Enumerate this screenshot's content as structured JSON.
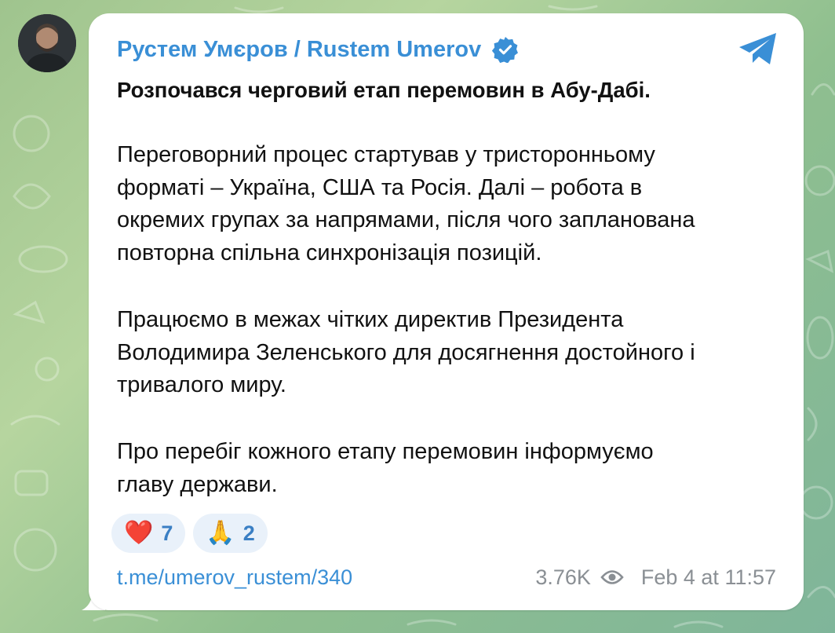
{
  "post": {
    "author": "Рустем Умєров / Rustem Umerov",
    "title": "Розпочався черговий етап перемовин в Абу-Дабі.",
    "paragraph1_lines": [
      "Переговорний процес стартував у тристоронньому",
      "форматі – Україна, США та Росія. Далі – робота в",
      "окремих групах за напрямами, після чого запланована",
      "повторна спільна синхронізація позицій."
    ],
    "paragraph2_lines": [
      "Працюємо в межах чітких директив Президента",
      "Володимира Зеленського для досягнення достойного і",
      "тривалого миру."
    ],
    "paragraph3_lines": [
      "Про перебіг кожного етапу перемовин інформуємо",
      "главу держави."
    ],
    "reactions": [
      {
        "emoji": "❤️",
        "count": "7"
      },
      {
        "emoji": "🙏",
        "count": "2"
      }
    ],
    "link": "t.me/umerov_rustem/340",
    "views": "3.76K",
    "date": "Feb 4 at 11:57"
  },
  "icons": {
    "verified": "verified-badge-icon",
    "telegram": "telegram-plane-icon",
    "views": "eye-icon"
  },
  "colors": {
    "accent": "#3a8fd6",
    "background": "#a6c994",
    "bubble": "#ffffff",
    "meta_text": "#8a8f94"
  }
}
